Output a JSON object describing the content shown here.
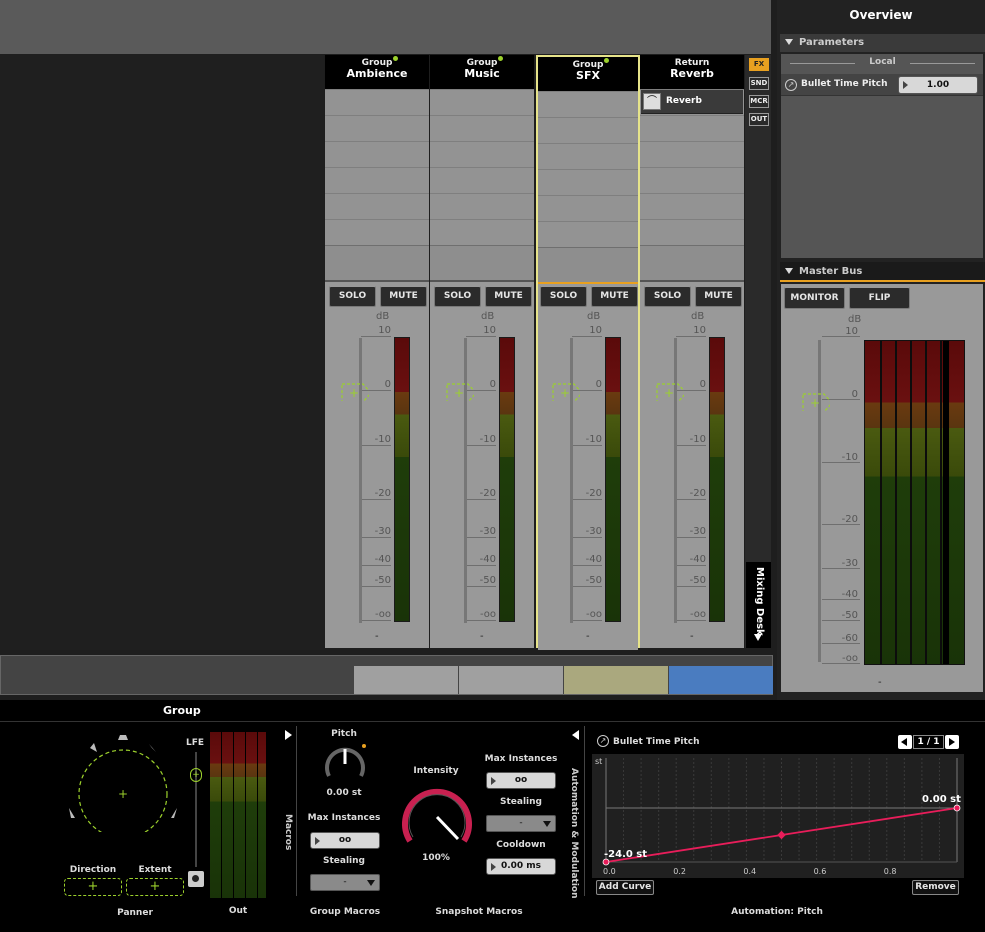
{
  "mixer": {
    "strips": [
      {
        "type": "Group",
        "name": "Ambience",
        "solo": "SOLO",
        "mute": "MUTE",
        "db": "dB",
        "value": "-"
      },
      {
        "type": "Group",
        "name": "Music",
        "solo": "SOLO",
        "mute": "MUTE",
        "db": "dB",
        "value": "-"
      },
      {
        "type": "Group",
        "name": "SFX",
        "solo": "SOLO",
        "mute": "MUTE",
        "db": "dB",
        "value": "-"
      },
      {
        "type": "Return",
        "name": "Reverb",
        "solo": "SOLO",
        "mute": "MUTE",
        "db": "dB",
        "value": "-",
        "effect": "Reverb"
      }
    ],
    "scale": [
      "10",
      "0",
      "-10",
      "-20",
      "-30",
      "-40",
      "-50",
      "-oo"
    ],
    "side_buttons": [
      "FX",
      "SND",
      "MCR",
      "OUT"
    ],
    "desk_label": "Mixing Desk",
    "colors": {
      "selected": "#e6e38a",
      "accent_green": "#9cd12c",
      "meter_red": "#6a0a0a"
    }
  },
  "overview": {
    "title": "Overview",
    "parameters": {
      "header": "Parameters",
      "local": "Local",
      "param_name": "Bullet Time Pitch",
      "param_value": "1.00"
    },
    "master_bus": {
      "header": "Master Bus",
      "monitor": "MONITOR",
      "flip": "FLIP",
      "db": "dB",
      "value": "-",
      "scale": [
        "10",
        "0",
        "-10",
        "-20",
        "-30",
        "-40",
        "-50",
        "-60",
        "-oo"
      ]
    }
  },
  "group_panel": {
    "title": "Group",
    "panner": {
      "label": "Panner",
      "lfe": "LFE",
      "direction": "Direction",
      "extent": "Extent"
    },
    "out": {
      "label": "Out"
    },
    "group_macros": {
      "label": "Group Macros",
      "side": "Macros",
      "pitch": "Pitch",
      "pitch_value": "0.00 st",
      "max_instances": "Max Instances",
      "max_value": "oo",
      "stealing": "Stealing",
      "stealing_value": "-"
    },
    "snapshot_macros": {
      "label": "Snapshot Macros",
      "intensity": "Intensity",
      "intensity_value": "100%",
      "max_instances": "Max Instances",
      "max_value": "oo",
      "stealing": "Stealing",
      "stealing_value": "-",
      "cooldown": "Cooldown",
      "cooldown_value": "0.00 ms"
    },
    "automation": {
      "side": "Automation & Modulation",
      "param": "Bullet Time Pitch",
      "page": "1 / 1",
      "unit": "st",
      "start_label": "-24.0 st",
      "end_label": "0.00 st",
      "x_ticks": [
        "0.0",
        "0.2",
        "0.4",
        "0.6",
        "0.8"
      ],
      "add_curve": "Add Curve",
      "remove": "Remove",
      "label": "Automation: Pitch",
      "curve": [
        [
          0,
          -24
        ],
        [
          0.5,
          -12
        ],
        [
          1,
          0
        ]
      ]
    }
  }
}
